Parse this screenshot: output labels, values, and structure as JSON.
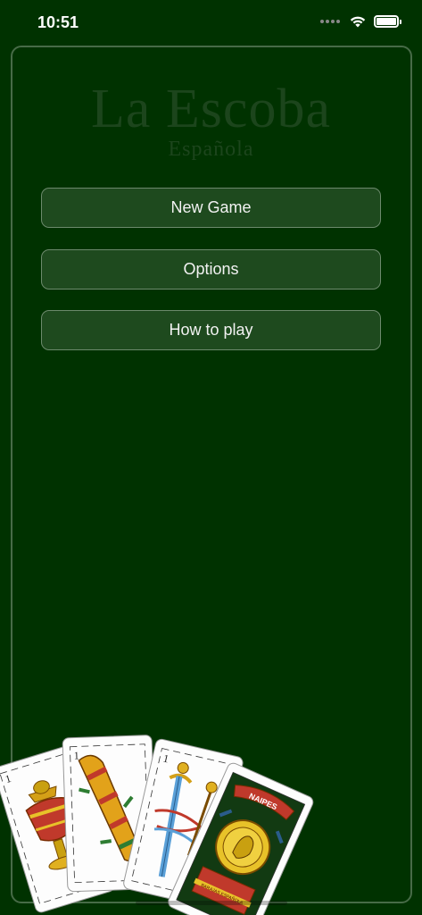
{
  "status_bar": {
    "time": "10:51",
    "icons": [
      "cellular-signal-icon",
      "wifi-icon",
      "battery-icon"
    ]
  },
  "header": {
    "title": "La Escoba",
    "subtitle": "Española"
  },
  "menu": {
    "new_game_label": "New Game",
    "options_label": "Options",
    "how_to_play_label": "How to play"
  },
  "decoration": {
    "cards": [
      {
        "suit": "copas",
        "number": "1"
      },
      {
        "suit": "bastos",
        "number": "1"
      },
      {
        "suit": "espadas",
        "number": "1"
      },
      {
        "suit": "oros",
        "number": "",
        "label": "NAIPES",
        "banner": "BARAJAS ESPAÑOLA"
      }
    ]
  },
  "colors": {
    "background": "#003200",
    "title": "#1c451c",
    "button": "#1e4a1e",
    "button_border": "#6f8a6f"
  }
}
